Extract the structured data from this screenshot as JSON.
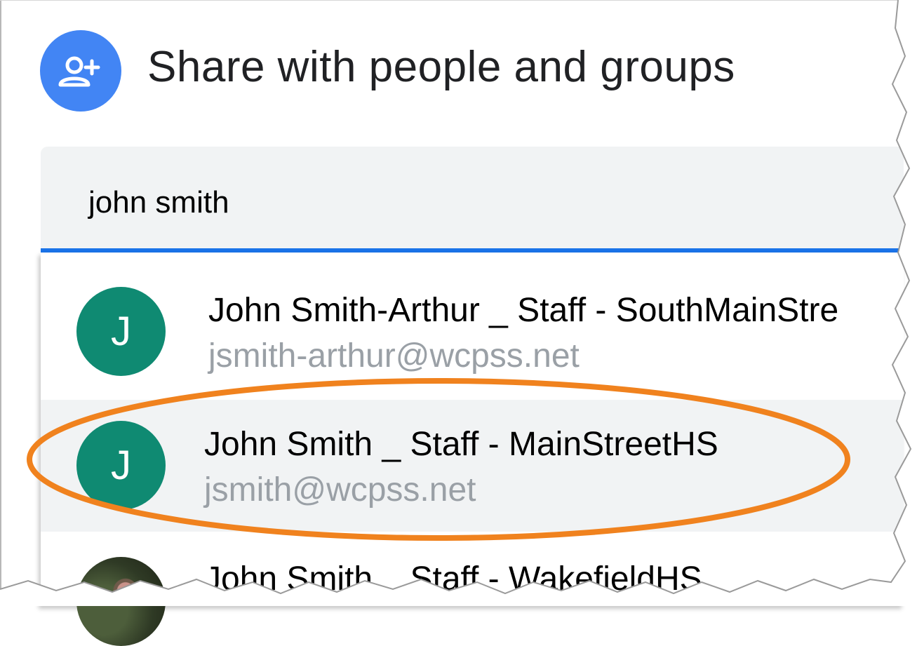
{
  "header": {
    "icon": "person-add-icon",
    "title": "Share with people and groups",
    "icon_color": "#4285f4"
  },
  "search": {
    "value": "john smith",
    "accent_color": "#1a73e8"
  },
  "suggestions": [
    {
      "initial": "J",
      "name": "John Smith-Arthur _ Staff - SouthMainStre",
      "email": "jsmith-arthur@wcpss.net",
      "avatar_color": "#0f8a72"
    },
    {
      "initial": "J",
      "name": "John Smith _ Staff - MainStreetHS",
      "email": "jsmith@wcpss.net",
      "avatar_color": "#0f8a72",
      "highlighted": true
    },
    {
      "avatar": "photo",
      "name": "John Smith _ Staff - WakefieldHS"
    }
  ],
  "annotation": {
    "shape": "ellipse",
    "color": "#f0821e"
  }
}
